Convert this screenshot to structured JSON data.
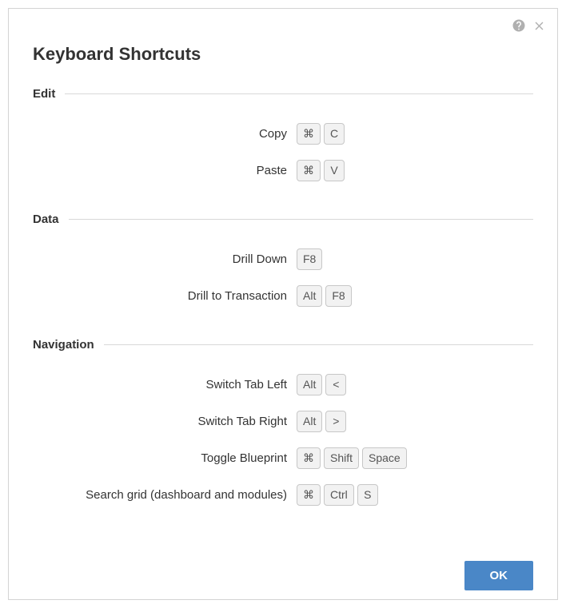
{
  "title": "Keyboard Shortcuts",
  "sections": {
    "edit": {
      "title": "Edit",
      "items": {
        "copy": {
          "label": "Copy",
          "keys": [
            "⌘",
            "C"
          ]
        },
        "paste": {
          "label": "Paste",
          "keys": [
            "⌘",
            "V"
          ]
        }
      }
    },
    "data": {
      "title": "Data",
      "items": {
        "drill_down": {
          "label": "Drill Down",
          "keys": [
            "F8"
          ]
        },
        "drill_transaction": {
          "label": "Drill to Transaction",
          "keys": [
            "Alt",
            "F8"
          ]
        }
      }
    },
    "navigation": {
      "title": "Navigation",
      "items": {
        "switch_left": {
          "label": "Switch Tab Left",
          "keys": [
            "Alt",
            "<"
          ]
        },
        "switch_right": {
          "label": "Switch Tab Right",
          "keys": [
            "Alt",
            ">"
          ]
        },
        "toggle_bp": {
          "label": "Toggle Blueprint",
          "keys": [
            "⌘",
            "Shift",
            "Space"
          ]
        },
        "search_grid": {
          "label": "Search grid (dashboard and modules)",
          "keys": [
            "⌘",
            "Ctrl",
            "S"
          ]
        }
      }
    }
  },
  "footer": {
    "ok_label": "OK"
  }
}
